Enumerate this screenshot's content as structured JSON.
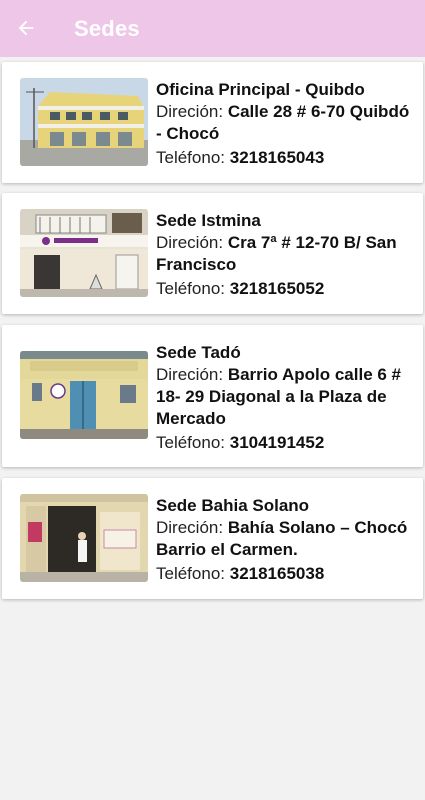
{
  "appbar": {
    "title": "Sedes",
    "back_icon": "arrow-left-icon",
    "color": "#eec6e7"
  },
  "labels": {
    "address": "Direción: ",
    "phone": "Teléfono: "
  },
  "sedes": [
    {
      "name": "Oficina Principal - Quibdo",
      "address": "Calle 28 # 6-70 Quibdó - Chocó",
      "phone": "3218165043",
      "photo": "building-photo-yellow-two-story"
    },
    {
      "name": "Sede Istmina",
      "address": "Cra 7ª # 12-70 B/ San Francisco",
      "phone": "3218165052",
      "photo": "building-photo-storefront-balcony"
    },
    {
      "name": "Sede Tadó",
      "address": "Barrio Apolo calle 6 # 18- 29 Diagonal a la Plaza de Mercado",
      "phone": "3104191452",
      "photo": "building-photo-single-story-blue-door"
    },
    {
      "name": "Sede Bahia Solano",
      "address": "Bahía Solano – Chocó Barrio el Carmen.",
      "phone": "3218165038",
      "photo": "building-photo-open-entrance"
    }
  ]
}
